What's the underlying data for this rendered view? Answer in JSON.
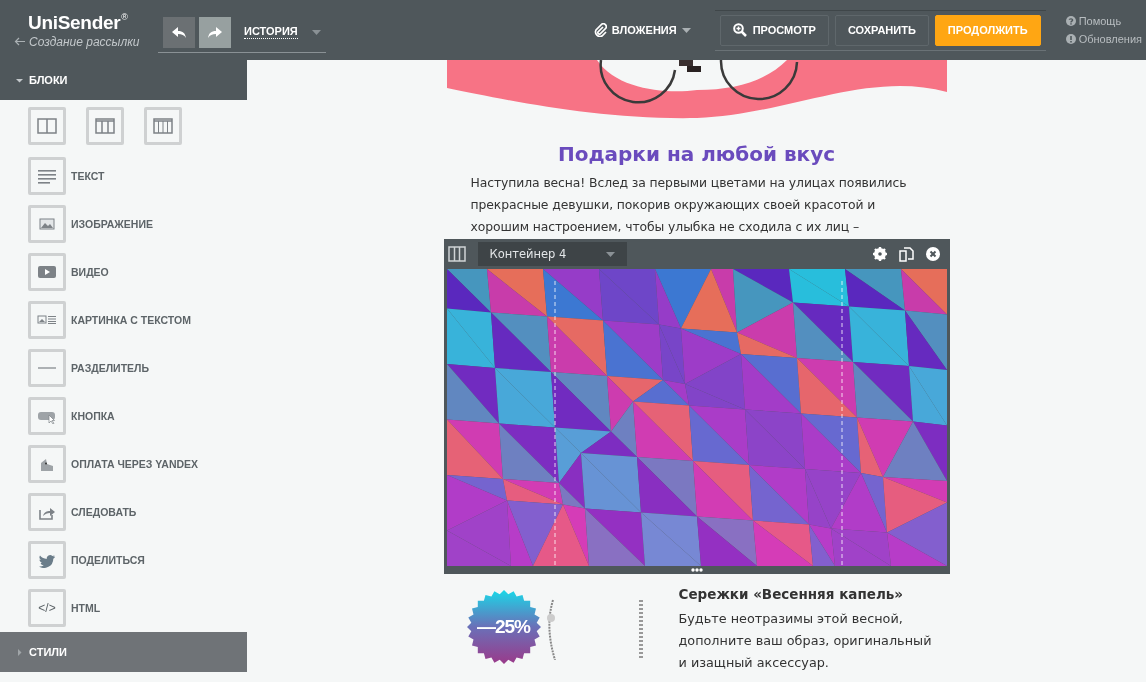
{
  "header": {
    "logo": "UniSender",
    "logo_mark": "®",
    "back_link": "Создание рассылки",
    "history": "ИСТОРИЯ",
    "attachments": "ВЛОЖЕНИЯ",
    "actions": [
      {
        "label": "ПРОСМОТР",
        "kind": "preview"
      },
      {
        "label": "СОХРАНИТЬ",
        "kind": "plain"
      },
      {
        "label": "ПРОДОЛЖИТЬ",
        "kind": "primary"
      }
    ],
    "help_links": [
      {
        "label": "Помощь",
        "kind": "help"
      },
      {
        "label": "Обновления",
        "kind": "updates"
      }
    ]
  },
  "sidebar": {
    "sections": [
      {
        "title": "БЛОКИ",
        "expanded": true,
        "layouts": [
          {
            "kind": "two_columns"
          },
          {
            "kind": "three_columns"
          },
          {
            "kind": "four_columns"
          }
        ],
        "items": [
          {
            "label": "ТЕКСТ",
            "kind": "text"
          },
          {
            "label": "ИЗОБРАЖЕНИЕ",
            "kind": "image"
          },
          {
            "label": "ВИДЕО",
            "kind": "video"
          },
          {
            "label": "КАРТИНКА С ТЕКСТОМ",
            "kind": "image_text"
          },
          {
            "label": "РАЗДЕЛИТЕЛЬ",
            "kind": "divider"
          },
          {
            "label": "КНОПКА",
            "kind": "button"
          },
          {
            "label": "ОПЛАТА ЧЕРЕЗ YANDEX",
            "kind": "payment"
          },
          {
            "label": "СЛЕДОВАТЬ",
            "kind": "follow"
          },
          {
            "label": "ПОДЕЛИТЬСЯ",
            "kind": "share"
          },
          {
            "label": "HTML",
            "kind": "html",
            "icon_text": "</>"
          }
        ]
      },
      {
        "title": "СТИЛИ",
        "expanded": false
      }
    ]
  },
  "email": {
    "heading": "Подарки на любой вкус",
    "paragraph": "Наступила весна! Вслед за первыми цветами на улицах появились прекрасные девушки, покорив окружающих своей красотой и хорошим настроением, чтобы улыбка не сходила с их лиц –",
    "container": {
      "title": "Контейнер 4"
    },
    "product": {
      "badge": "—25%",
      "title": "Сережки «Весенняя капель»",
      "description": "Будьте неотразимы этой весной, дополните ваш образ, оригинальный и изащный аксессуар."
    }
  }
}
